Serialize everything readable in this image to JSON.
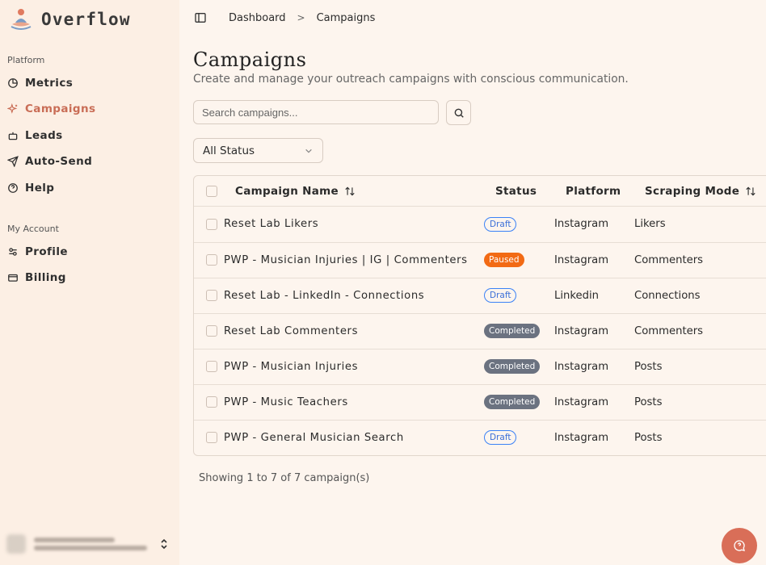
{
  "app": {
    "name": "Overflow"
  },
  "sidebar": {
    "platform_label": "Platform",
    "platform_items": [
      {
        "label": "Metrics",
        "icon": "pie-chart-icon",
        "active": false
      },
      {
        "label": "Campaigns",
        "icon": "sparkles-icon",
        "active": true
      },
      {
        "label": "Leads",
        "icon": "bot-icon",
        "active": false
      },
      {
        "label": "Auto-Send",
        "icon": "send-icon",
        "active": false
      },
      {
        "label": "Help",
        "icon": "help-circle-icon",
        "active": false
      }
    ],
    "account_label": "My Account",
    "account_items": [
      {
        "label": "Profile",
        "icon": "sliders-icon"
      },
      {
        "label": "Billing",
        "icon": "credit-card-icon"
      }
    ]
  },
  "breadcrumb": {
    "items": [
      "Dashboard",
      "Campaigns"
    ],
    "separator": ">"
  },
  "page": {
    "title": "Campaigns",
    "subtitle": "Create and manage your outreach campaigns with conscious communication."
  },
  "search": {
    "placeholder": "Search campaigns...",
    "value": ""
  },
  "filter": {
    "selected": "All Status"
  },
  "table": {
    "columns": [
      "Campaign Name",
      "Status",
      "Platform",
      "Scraping Mode"
    ],
    "rows": [
      {
        "name": "Reset Lab Likers",
        "status": "Draft",
        "platform": "Instagram",
        "mode": "Likers"
      },
      {
        "name": "PWP - Musician Injuries | IG | Commenters",
        "status": "Paused",
        "platform": "Instagram",
        "mode": "Commenters"
      },
      {
        "name": "Reset Lab - LinkedIn - Connections",
        "status": "Draft",
        "platform": "Linkedin",
        "mode": "Connections"
      },
      {
        "name": "Reset Lab Commenters",
        "status": "Completed",
        "platform": "Instagram",
        "mode": "Commenters"
      },
      {
        "name": "PWP - Musician Injuries",
        "status": "Completed",
        "platform": "Instagram",
        "mode": "Posts"
      },
      {
        "name": "PWP - Music Teachers",
        "status": "Completed",
        "platform": "Instagram",
        "mode": "Posts"
      },
      {
        "name": "PWP - General Musician Search",
        "status": "Draft",
        "platform": "Instagram",
        "mode": "Posts"
      }
    ]
  },
  "footer": {
    "showing": "Showing 1 to 7 of 7 campaign(s)"
  },
  "colors": {
    "accent": "#c96d56",
    "fab": "#d96e58",
    "draft": "#3b82f6",
    "paused": "#f26a14",
    "completed": "#6b7280",
    "background": "#fdf5ee",
    "sidebar": "#fcefe4"
  }
}
